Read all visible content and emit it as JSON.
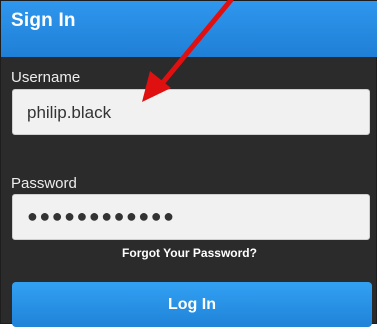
{
  "header": {
    "title": "Sign In"
  },
  "username": {
    "label": "Username",
    "value": "philip.black"
  },
  "password": {
    "label": "Password",
    "masked_value": "●●●●●●●●●●●●"
  },
  "forgot_password": {
    "label": "Forgot Your Password?"
  },
  "login_button": {
    "label": "Log In"
  },
  "colors": {
    "panel_bg": "#2b2b2b",
    "header_blue": "#1f7fd6",
    "button_blue": "#1f83d8",
    "annotation_red": "#e01010"
  }
}
